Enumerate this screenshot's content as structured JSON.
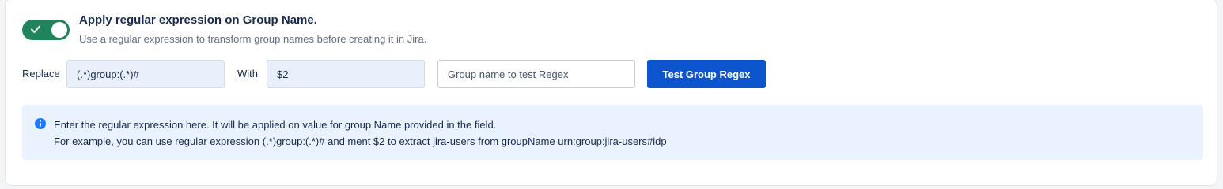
{
  "toggle": {
    "state": "on",
    "color": "#1f845a",
    "icon": "check-icon"
  },
  "header": {
    "title": "Apply regular expression on Group Name.",
    "subtitle": "Use a regular expression to transform group names before creating it in Jira."
  },
  "form": {
    "replace_label": "Replace",
    "replace_value": "(.*)group:(.*)#",
    "with_label": "With",
    "with_value": "$2",
    "test_placeholder": "Group name to test Regex",
    "test_button_label": "Test Group Regex",
    "button_color": "#0c55cf"
  },
  "info": {
    "icon": "info-icon",
    "line1": "Enter the regular expression here. It will be applied on value for group Name provided in the field.",
    "line2": "For example, you can use regular expression (.*)group:(.*)# and ment $2 to extract jira-users from groupName urn:group:jira-users#idp"
  }
}
